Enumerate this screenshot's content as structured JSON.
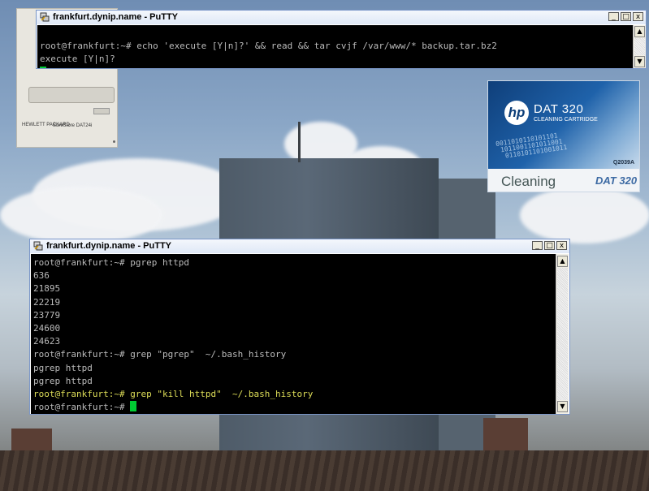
{
  "windows": [
    {
      "title": "frankfurt.dynip.name - PuTTY",
      "lines": [
        {
          "text": "root@frankfurt:~# echo 'execute [Y|n]?' && read && tar cvjf /var/www/* backup.tar.bz2",
          "highlight": false
        },
        {
          "text": "execute [Y|n]?",
          "highlight": false
        }
      ],
      "buttons": {
        "minimize": "_",
        "maximize": "□",
        "close": "x"
      }
    },
    {
      "title": "frankfurt.dynip.name - PuTTY",
      "lines": [
        {
          "text": "root@frankfurt:~# pgrep httpd",
          "highlight": false
        },
        {
          "text": "636",
          "highlight": false
        },
        {
          "text": "21895",
          "highlight": false
        },
        {
          "text": "22219",
          "highlight": false
        },
        {
          "text": "23779",
          "highlight": false
        },
        {
          "text": "24600",
          "highlight": false
        },
        {
          "text": "24623",
          "highlight": false
        },
        {
          "text": "root@frankfurt:~# grep \"pgrep\"  ~/.bash_history",
          "highlight": false
        },
        {
          "text": "pgrep httpd",
          "highlight": false
        },
        {
          "text": "pgrep httpd",
          "highlight": false
        },
        {
          "text": "root@frankfurt:~# grep \"kill httpd\"  ~/.bash_history",
          "highlight": true
        },
        {
          "text": "root@frankfurt:~# ",
          "highlight": false
        }
      ],
      "buttons": {
        "minimize": "_",
        "maximize": "□",
        "close": "x"
      }
    }
  ],
  "scroll": {
    "up": "▲",
    "down": "▼"
  },
  "colors": {
    "terminal_bg": "#000000",
    "terminal_text": "#bbbbbb",
    "highlight_text": "#dede58",
    "cursor": "#00cc33",
    "titlebar": "#dfe8f6"
  },
  "icons": {
    "window": "putty-icon"
  },
  "tape_drive": {
    "brand": "HEWLETT PACKARD",
    "model": "SureStore DAT24i"
  },
  "cartridge": {
    "logo": "hp",
    "title": "DAT 320",
    "subtitle": "CLEANING CARTRIDGE",
    "code": "Q2039A",
    "label": "Cleaning",
    "badge": "DAT 320"
  }
}
